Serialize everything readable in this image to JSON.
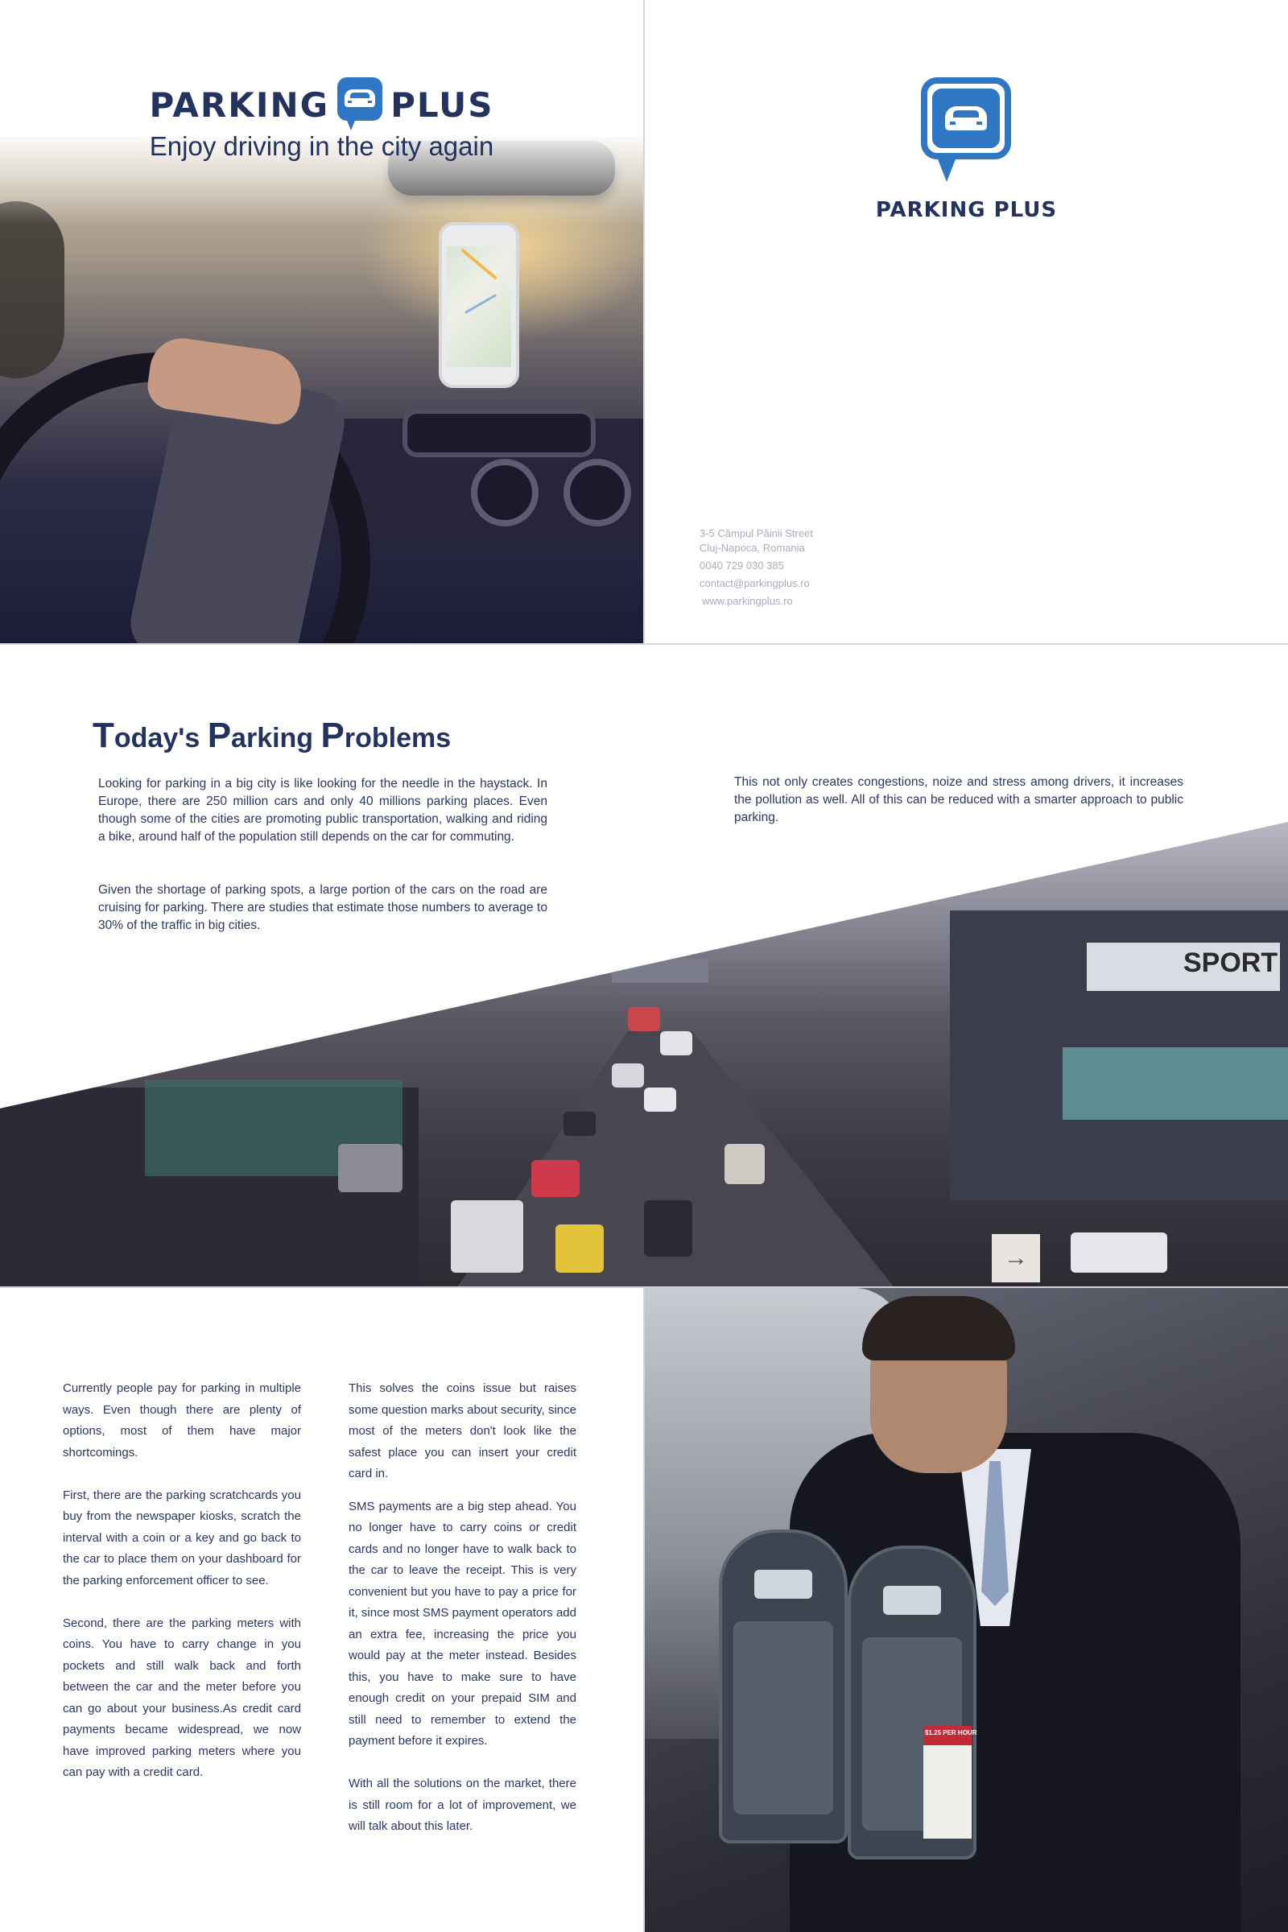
{
  "brand": {
    "name_left": "PARKING",
    "name_right": "PLUS",
    "back_logo": "PARKING PLUS",
    "tagline": "Enjoy driving in the city again",
    "accent": "#2f76c4",
    "navy": "#23335e"
  },
  "contact": {
    "street": "3-5 Câmpul Pâinii Street",
    "city": "Cluj-Napoca, Romania",
    "phone": "0040 729 030 385",
    "email": "contact@parkingplus.ro",
    "website": "www.parkingplus.ro"
  },
  "problems": {
    "title_first": "T",
    "title_rest": "oday's ",
    "title_second": "P",
    "title_rest2": "arking ",
    "title_third": "P",
    "title_rest3": "roblems",
    "para1": "Looking for parking in a big city is like looking for the needle in the haystack. In Europe, there are 250 million cars and only 40 millions parking places. Even though some of the cities are promoting public transportation, walking and riding a bike, around half of the population still depends on the car for commuting.",
    "para2": "Given the shortage of parking spots, a large portion of the cars on the road are cruising for parking. There are studies that estimate those numbers to average to 30% of the traffic in big cities.",
    "para3": "This not only creates congestions, noize and stress among drivers, it increases the pollution as well. All of this can be reduced with a smarter approach to public parking."
  },
  "traffic_photo": {
    "sign_text": "SPORT",
    "arrow": "→"
  },
  "payments": {
    "col_a": [
      "Currently people pay for parking in multiple ways. Even though there are plenty of options, most of them have major shortcomings.",
      "First, there are the parking scratchcards you buy from the newspaper kiosks, scratch the interval with a coin or a key and go back to the car to place them on your dashboard for the parking enforcement officer to see.",
      "Second, there are the parking meters with coins. You have to carry change in you pockets and still walk back and forth between the car and the meter before you can go about your business.As credit card payments became widespread, we now have improved parking meters where you can pay with a credit card."
    ],
    "col_b": [
      "This solves the coins issue but raises some question marks about security, since most of the meters don't look like the safest place you can insert your credit card in.",
      "SMS payments are a big step ahead. You no longer have to carry coins or credit cards and no longer have to walk back to the car to leave the receipt. This is very convenient but you have to pay a price for it, since most SMS payment operators add an extra fee, increasing the price you would pay at the meter instead. Besides this, you have to make sure to have enough credit on your prepaid SIM and still need to remember to extend the payment before it expires.",
      "With all the solutions on the market, there is still room for a lot of improvement, we will talk about this later."
    ]
  },
  "meter_photo": {
    "tag_text": "$1.25 PER HOUR"
  }
}
